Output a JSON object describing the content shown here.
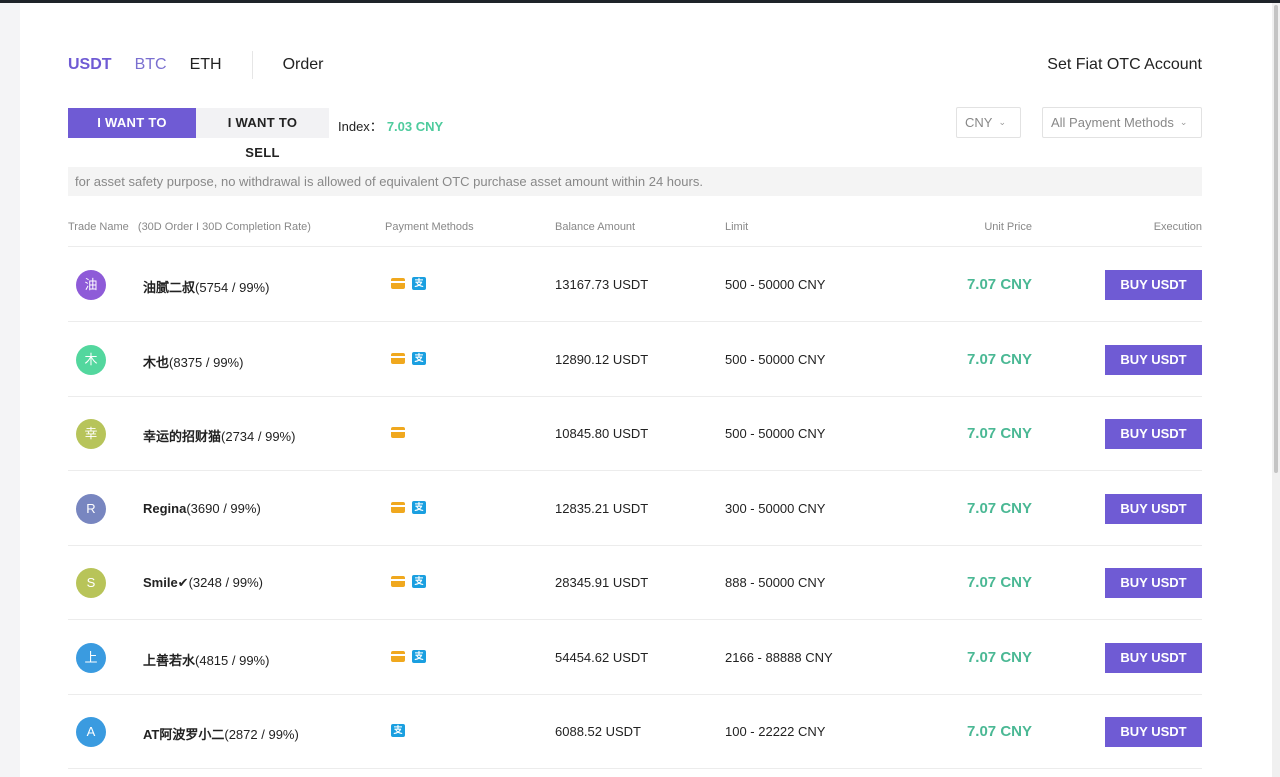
{
  "coin_tabs": [
    "USDT",
    "BTC",
    "ETH"
  ],
  "order_label": "Order",
  "otc_account_label": "Set Fiat OTC Account",
  "buy_label": "I WANT TO BUY",
  "sell_label": "I WANT TO SELL",
  "index_label": "Index：",
  "index_value": "7.03 CNY",
  "currency_select": "CNY",
  "payment_select": "All Payment Methods",
  "notice": "for asset safety purpose, no withdrawal is allowed of equivalent OTC purchase asset amount within 24 hours.",
  "columns": {
    "trade_name": "Trade Name",
    "trade_sub": "(30D Order I 30D Completion Rate)",
    "payment": "Payment Methods",
    "balance": "Balance Amount",
    "limit": "Limit",
    "price": "Unit Price",
    "execution": "Execution"
  },
  "colors": {
    "accent": "#6f5bd4",
    "price_green": "#4ab894",
    "index_green": "#4ecb9d",
    "bank_icon": "#f0a81e",
    "alipay_icon": "#1a9fe0"
  },
  "icons": {
    "bank": "bank-card-icon",
    "alipay": "alipay-icon",
    "chevron": "chevron-down-icon"
  },
  "rows": [
    {
      "avatar": "油",
      "avatar_color": "#8e5bd8",
      "name": "油腻二叔",
      "stats": "(5754 / 99%)",
      "bank": true,
      "alipay": true,
      "balance": "13167.73 USDT",
      "limit": "500 - 50000 CNY",
      "price": "7.07 CNY",
      "button": "BUY USDT"
    },
    {
      "avatar": "木",
      "avatar_color": "#53d79e",
      "name": "木也",
      "stats": "(8375 / 99%)",
      "bank": true,
      "alipay": true,
      "balance": "12890.12 USDT",
      "limit": "500 - 50000 CNY",
      "price": "7.07 CNY",
      "button": "BUY USDT"
    },
    {
      "avatar": "幸",
      "avatar_color": "#b7c45a",
      "name": "幸运的招财猫",
      "stats": "(2734 / 99%)",
      "bank": true,
      "alipay": false,
      "balance": "10845.80 USDT",
      "limit": "500 - 50000 CNY",
      "price": "7.07 CNY",
      "button": "BUY USDT"
    },
    {
      "avatar": "R",
      "avatar_color": "#7886c0",
      "name": "Regina",
      "stats": "(3690 / 99%)",
      "bank": true,
      "alipay": true,
      "balance": "12835.21 USDT",
      "limit": "300 - 50000 CNY",
      "price": "7.07 CNY",
      "button": "BUY USDT"
    },
    {
      "avatar": "S",
      "avatar_color": "#b8c459",
      "name": "Smile✔",
      "stats": "(3248 / 99%)",
      "bank": true,
      "alipay": true,
      "balance": "28345.91 USDT",
      "limit": "888 - 50000 CNY",
      "price": "7.07 CNY",
      "button": "BUY USDT"
    },
    {
      "avatar": "上",
      "avatar_color": "#3a9be0",
      "name": "上善若水",
      "stats": "(4815 / 99%)",
      "bank": true,
      "alipay": true,
      "balance": "54454.62 USDT",
      "limit": "2166 - 88888 CNY",
      "price": "7.07 CNY",
      "button": "BUY USDT"
    },
    {
      "avatar": "A",
      "avatar_color": "#3a9be0",
      "name": "AT阿波罗小二",
      "stats": "(2872 / 99%)",
      "bank": false,
      "alipay": true,
      "balance": "6088.52 USDT",
      "limit": "100 - 22222 CNY",
      "price": "7.07 CNY",
      "button": "BUY USDT"
    }
  ]
}
